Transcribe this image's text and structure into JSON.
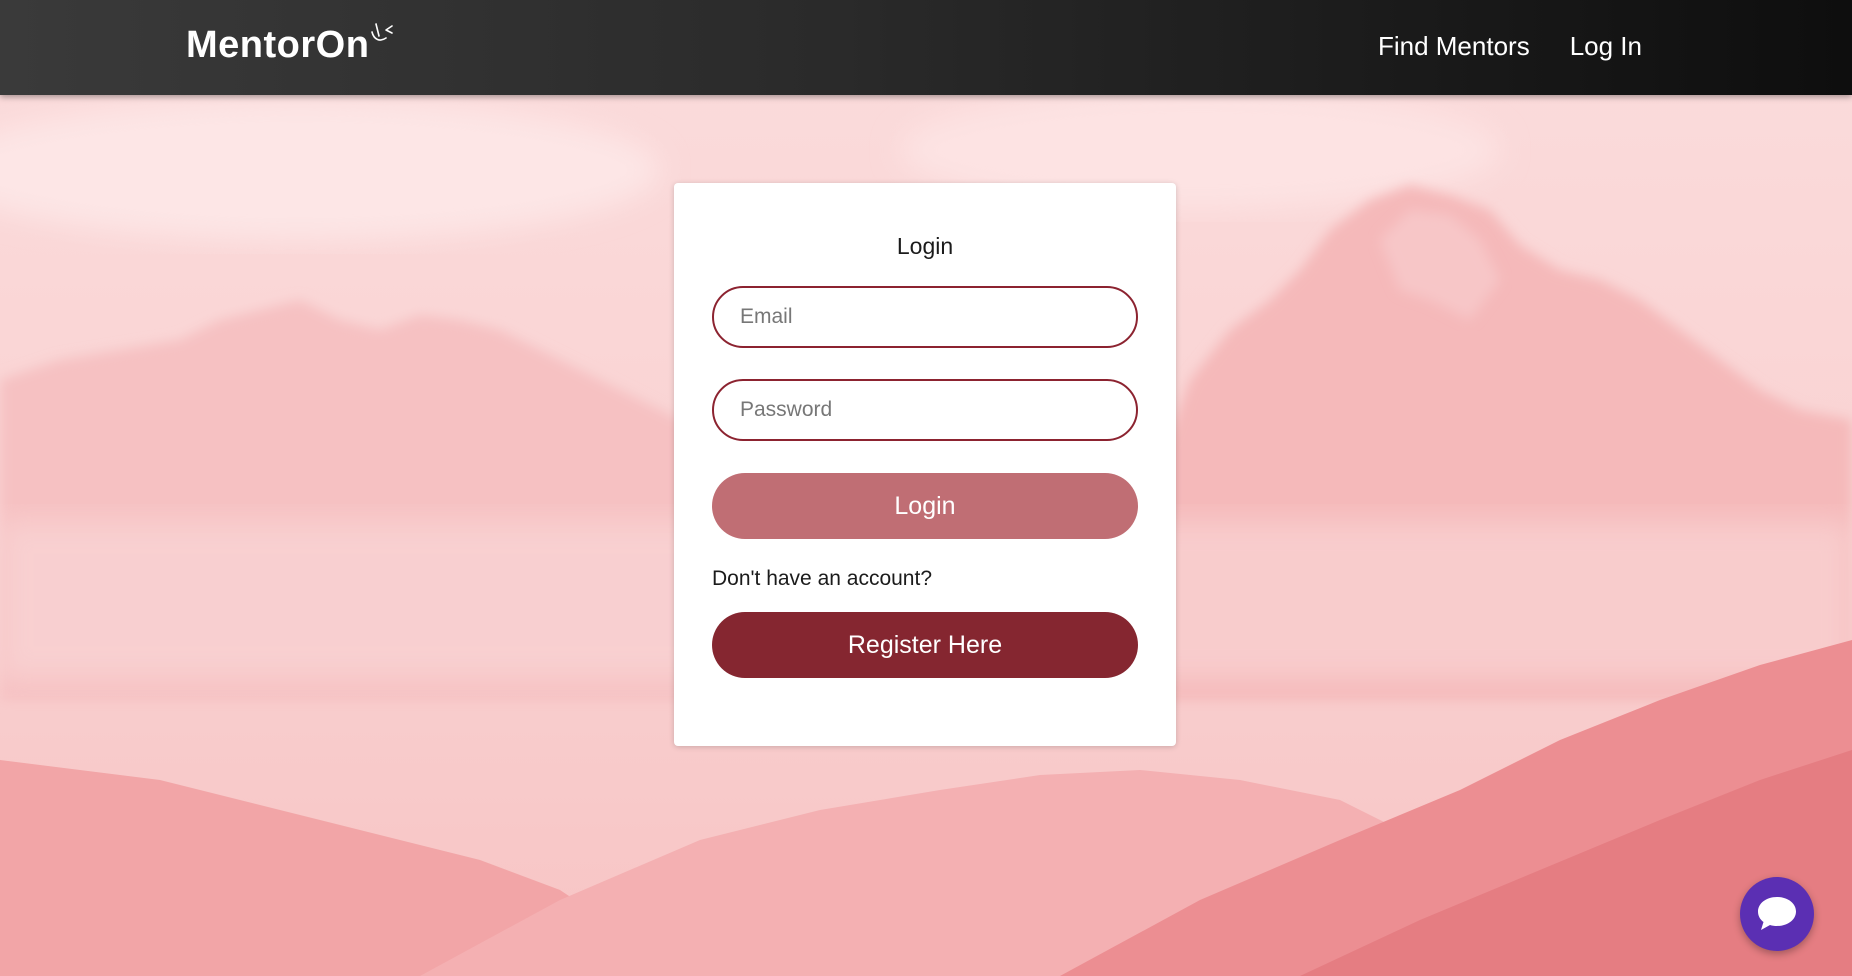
{
  "navbar": {
    "brand": "MentorOn",
    "links": [
      {
        "label": "Find Mentors"
      },
      {
        "label": "Log In"
      }
    ]
  },
  "login_card": {
    "title": "Login",
    "email_placeholder": "Email",
    "password_placeholder": "Password",
    "login_button": "Login",
    "no_account_text": "Don't have an account?",
    "register_button": "Register Here"
  },
  "chat": {
    "icon": "chat-bubble-icon"
  },
  "colors": {
    "navbar": "#1e1e1e",
    "field_border": "#8c2330",
    "login_button": "#c06e74",
    "register_button": "#852630",
    "chat_button": "#5b2fb3",
    "background_tint": "#f6c9c9"
  }
}
